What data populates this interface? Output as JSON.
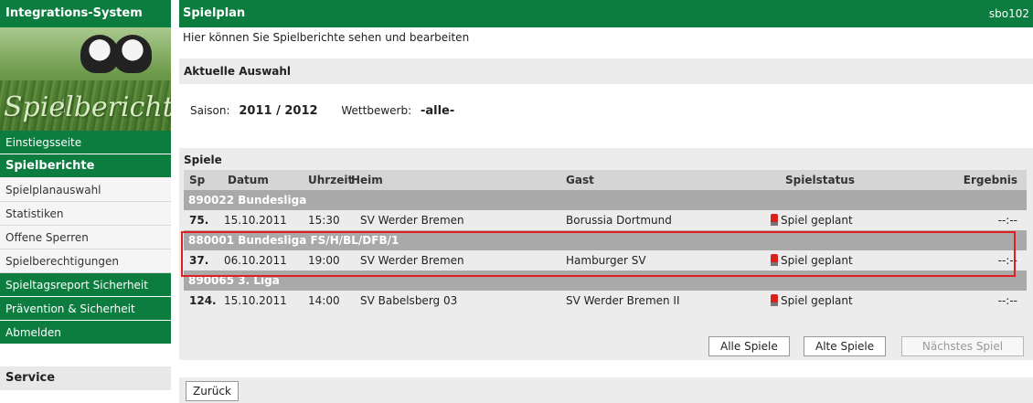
{
  "sidebar": {
    "title": "Integrations-System",
    "banner_text": "Spielbericht",
    "items": [
      {
        "label": "Einstiegsseite",
        "style": "green"
      },
      {
        "label": "Spielberichte",
        "style": "active"
      },
      {
        "label": "Spielplanauswahl",
        "style": "plain"
      },
      {
        "label": "Statistiken",
        "style": "plain"
      },
      {
        "label": "Offene Sperren",
        "style": "plain"
      },
      {
        "label": "Spielberechtigungen",
        "style": "plain"
      },
      {
        "label": "Spieltagsreport Sicherheit",
        "style": "green"
      },
      {
        "label": "Prävention & Sicherheit",
        "style": "green"
      },
      {
        "label": "Abmelden",
        "style": "green"
      }
    ],
    "service_title": "Service"
  },
  "header": {
    "title": "Spielplan",
    "code": "sbo102",
    "subtitle": "Hier können Sie Spielberichte sehen und bearbeiten"
  },
  "selection": {
    "title": "Aktuelle Auswahl",
    "saison_label": "Saison:",
    "saison_value": "2011 / 2012",
    "wettbewerb_label": "Wettbewerb:",
    "wettbewerb_value": "-alle-"
  },
  "games": {
    "title": "Spiele",
    "columns": {
      "sp": "Sp",
      "datum": "Datum",
      "uhrzeit": "Uhrzeit",
      "heim": "Heim",
      "gast": "Gast",
      "status": "Spielstatus",
      "ergebnis": "Ergebnis"
    },
    "groups": [
      {
        "name": "890022 Bundesliga",
        "game": {
          "sp": "75.",
          "datum": "15.10.2011",
          "uhrzeit": "15:30",
          "heim": "SV Werder Bremen",
          "gast": "Borussia Dortmund",
          "status": "Spiel geplant",
          "ergebnis": "--:--"
        }
      },
      {
        "name": "880001 Bundesliga FS/H/BL/DFB/1",
        "game": {
          "sp": "37.",
          "datum": "06.10.2011",
          "uhrzeit": "19:00",
          "heim": "SV Werder Bremen",
          "gast": "Hamburger SV",
          "status": "Spiel geplant",
          "ergebnis": "--:--"
        }
      },
      {
        "name": "890065 3. Liga",
        "game": {
          "sp": "124.",
          "datum": "15.10.2011",
          "uhrzeit": "14:00",
          "heim": "SV Babelsberg 03",
          "gast": "SV Werder Bremen II",
          "status": "Spiel geplant",
          "ergebnis": "--:--"
        }
      }
    ],
    "highlight_color": "#e02020"
  },
  "buttons": {
    "all_games": "Alle Spiele",
    "old_games": "Alte Spiele",
    "next_game": "Nächstes Spiel",
    "back": "Zurück"
  },
  "colors": {
    "brand_green": "#0c7c3f",
    "group_gray": "#a9a9a9",
    "panel_gray": "#ececec"
  }
}
